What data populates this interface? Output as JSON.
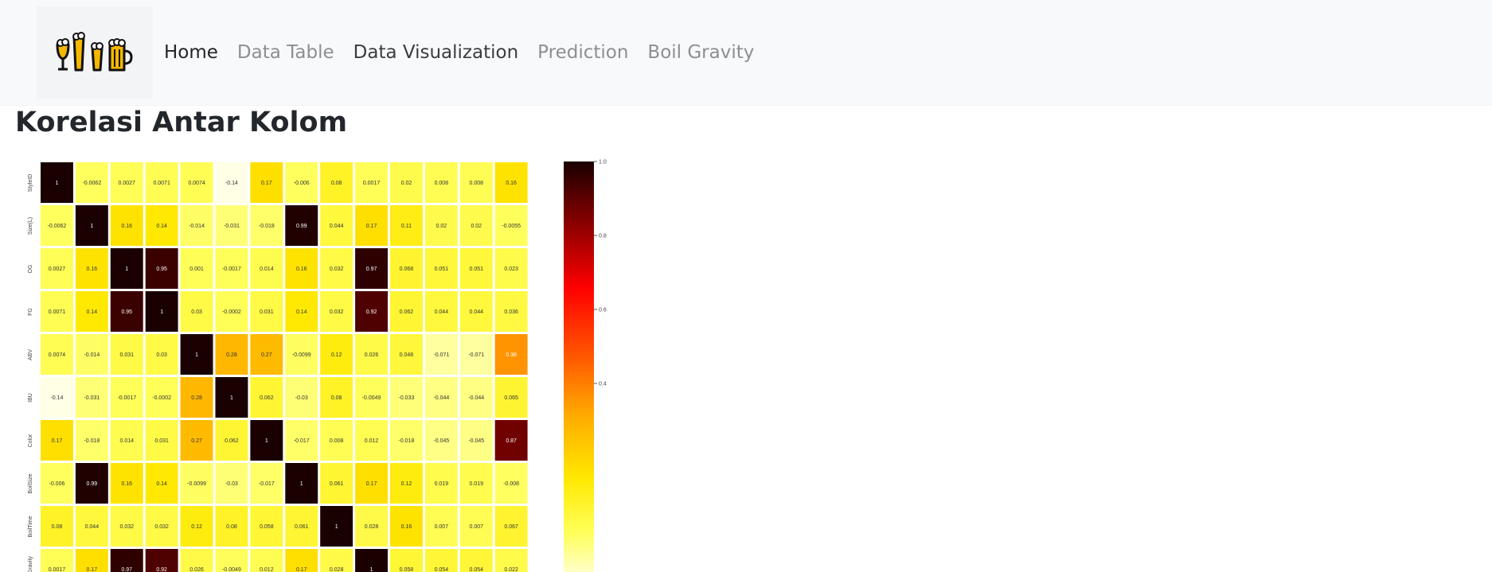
{
  "nav": {
    "items": [
      {
        "label": "Home",
        "state": "active"
      },
      {
        "label": "Data Table",
        "state": "normal"
      },
      {
        "label": "Data Visualization",
        "state": "dark"
      },
      {
        "label": "Prediction",
        "state": "normal"
      },
      {
        "label": "Boil Gravity",
        "state": "normal"
      }
    ]
  },
  "page": {
    "title": "Korelasi Antar Kolom"
  },
  "chart_data": {
    "type": "heatmap",
    "row_labels": [
      "StyleID",
      "Size(L)",
      "OG",
      "FG",
      "ABV",
      "IBU",
      "Color",
      "BoilSize",
      "BoilTime",
      "BoilGravity"
    ],
    "col_count": 14,
    "values": [
      [
        "1",
        "-0.0062",
        "0.0027",
        "0.0071",
        "0.0074",
        "-0.14",
        "0.17",
        "-0.006",
        "0.08",
        "0.0017",
        "0.02",
        "0.008",
        "0.008",
        "0.16"
      ],
      [
        "-0.0062",
        "1",
        "0.16",
        "0.14",
        "-0.014",
        "-0.031",
        "-0.018",
        "0.99",
        "0.044",
        "0.17",
        "0.11",
        "0.02",
        "0.02",
        "-0.0055"
      ],
      [
        "0.0027",
        "0.16",
        "1",
        "0.95",
        "0.001",
        "-0.0017",
        "0.014",
        "0.16",
        "0.032",
        "0.97",
        "0.068",
        "0.051",
        "0.051",
        "0.023"
      ],
      [
        "0.0071",
        "0.14",
        "0.95",
        "1",
        "0.03",
        "-0.0002",
        "0.031",
        "0.14",
        "0.032",
        "0.92",
        "0.062",
        "0.044",
        "0.044",
        "0.036"
      ],
      [
        "0.0074",
        "-0.014",
        "0.031",
        "0.03",
        "1",
        "0.28",
        "0.27",
        "-0.0099",
        "0.12",
        "0.026",
        "0.048",
        "-0.071",
        "-0.071",
        "0.36"
      ],
      [
        "-0.14",
        "-0.031",
        "-0.0017",
        "-0.0002",
        "0.28",
        "1",
        "0.062",
        "-0.03",
        "0.08",
        "-0.0049",
        "-0.033",
        "-0.044",
        "-0.044",
        "0.065"
      ],
      [
        "0.17",
        "-0.018",
        "0.014",
        "0.031",
        "0.27",
        "0.062",
        "1",
        "-0.017",
        "0.008",
        "0.012",
        "-0.018",
        "-0.045",
        "-0.045",
        "0.87"
      ],
      [
        "-0.006",
        "0.99",
        "0.16",
        "0.14",
        "-0.0099",
        "-0.03",
        "-0.017",
        "1",
        "0.061",
        "0.17",
        "0.12",
        "0.019",
        "0.019",
        "-0.008"
      ],
      [
        "0.08",
        "0.044",
        "0.032",
        "0.032",
        "0.12",
        "0.08",
        "0.058",
        "0.061",
        "1",
        "0.028",
        "0.16",
        "0.007",
        "0.007",
        "0.067"
      ],
      [
        "0.0017",
        "0.17",
        "0.97",
        "0.92",
        "0.026",
        "-0.0049",
        "0.012",
        "0.17",
        "0.028",
        "1",
        "0.058",
        "0.054",
        "0.054",
        "0.022"
      ]
    ],
    "colorbar": {
      "ticks": [
        "1.0",
        "0.8",
        "0.6",
        "0.4"
      ],
      "range": [
        -0.14,
        1.0
      ]
    },
    "colors": {
      "high": "#1a0000",
      "mid": "#ff0000",
      "low": "#ffff66"
    }
  }
}
